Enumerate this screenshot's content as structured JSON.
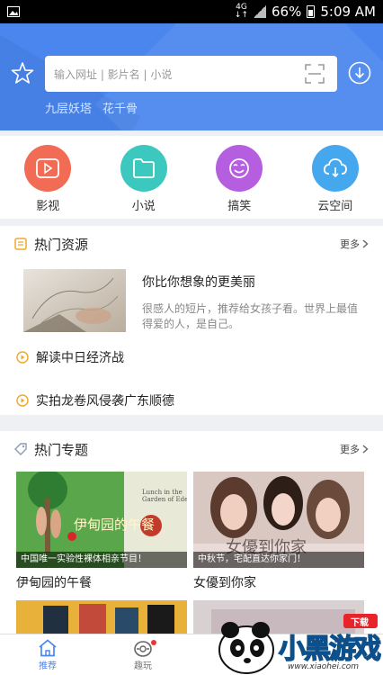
{
  "status_bar": {
    "network": "4G",
    "battery": "66%",
    "time": "5:09 AM"
  },
  "header": {
    "search_placeholder": "输入网址 | 影片名 | 小说",
    "hot_words": [
      "九层妖塔",
      "花千骨"
    ],
    "accent_color": "#4a86ee"
  },
  "categories": [
    {
      "label": "影视",
      "color": "#f16b55",
      "icon": "play-icon"
    },
    {
      "label": "小说",
      "color": "#3cc7bf",
      "icon": "book-icon"
    },
    {
      "label": "搞笑",
      "color": "#b55ee0",
      "icon": "smiley-icon"
    },
    {
      "label": "云空间",
      "color": "#45a8ef",
      "icon": "cloud-icon"
    }
  ],
  "hot_resources": {
    "title": "热门资源",
    "more": "更多",
    "featured": {
      "title": "你比你想象的更美丽",
      "description": "很感人的短片，推荐给女孩子看。世界上最值得爱的人，是自己。"
    },
    "items": [
      "解读中日经济战",
      "实拍龙卷风侵袭广东顺德"
    ]
  },
  "hot_topics": {
    "title": "热门专题",
    "more": "更多",
    "cards": [
      {
        "caption": "中国唯一实验性裸体相亲节目！",
        "name": "伊甸园的午餐",
        "poster_text": "伊甸园的午餐"
      },
      {
        "caption": "中秋节，宅配直达你家门！",
        "name": "女優到你家",
        "poster_text": "女優到你家"
      }
    ]
  },
  "bottom_nav": [
    {
      "label": "推荐",
      "active": true
    },
    {
      "label": "趣玩",
      "active": false
    }
  ],
  "watermark": {
    "brand": "小黑游戏",
    "badge": "下载",
    "url": "www.xiaohei.com"
  }
}
